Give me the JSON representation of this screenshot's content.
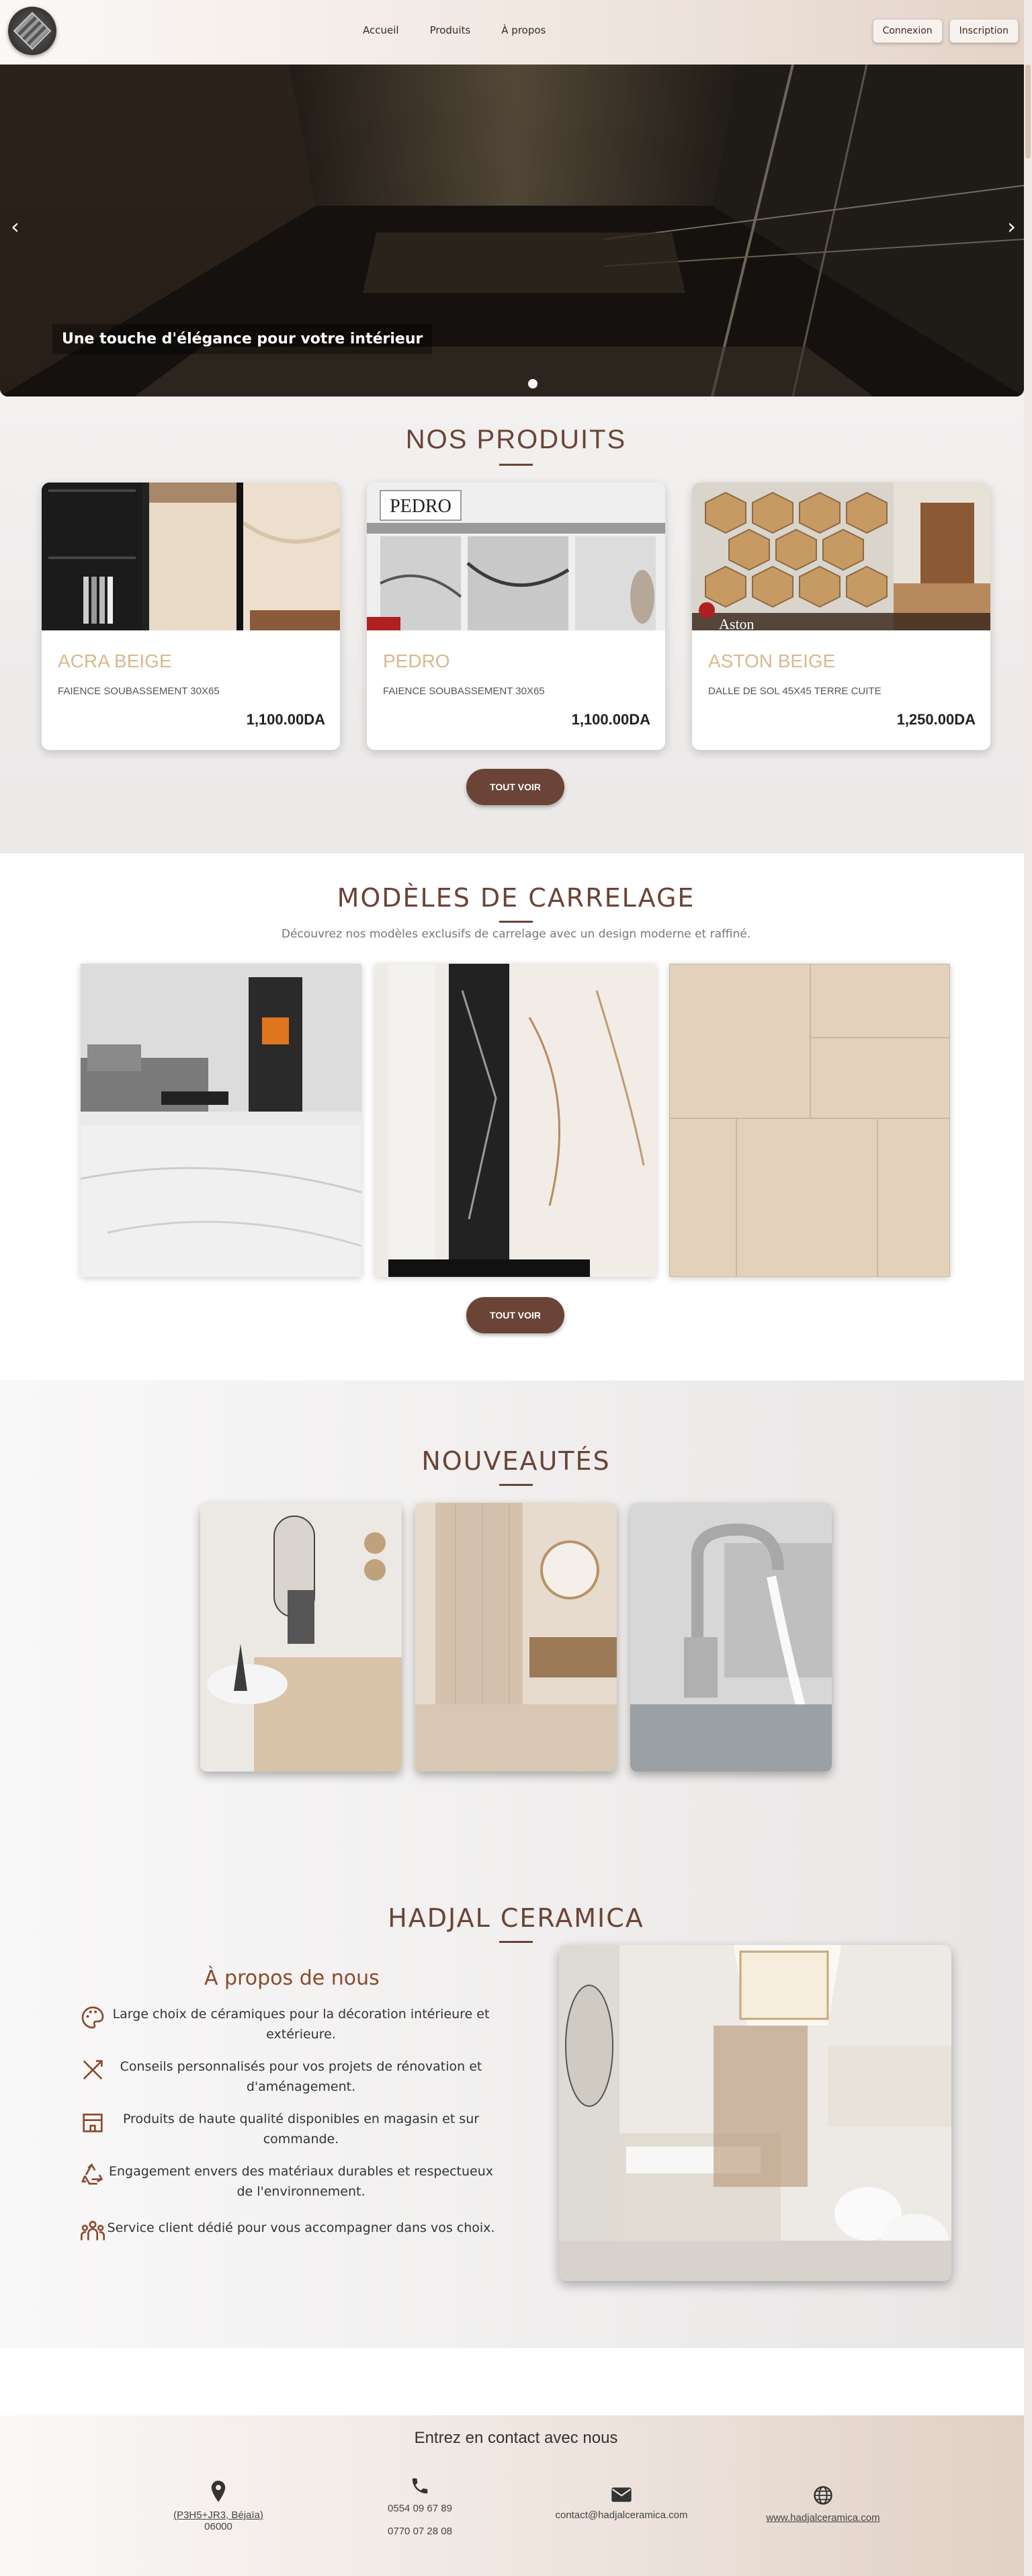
{
  "nav": {
    "links": [
      "Accueil",
      "Produits",
      "À propos"
    ],
    "login": "Connexion",
    "signup": "Inscription"
  },
  "hero": {
    "caption": "Une touche d'élégance pour votre intérieur",
    "prev": "‹",
    "next": "›"
  },
  "products": {
    "title": "NOS PRODUITS",
    "items": [
      {
        "name": "ACRA BEIGE",
        "desc": "FAIENCE SOUBASSEMENT 30X65",
        "price": "1,100.00DA"
      },
      {
        "name": "PEDRO",
        "desc": "FAIENCE SOUBASSEMENT 30X65",
        "price": "1,100.00DA"
      },
      {
        "name": "ASTON BEIGE",
        "desc": "DALLE DE SOL 45X45 TERRE CUITE",
        "price": "1,250.00DA"
      }
    ],
    "button": "TOUT VOIR",
    "image_labels": {
      "pedro": "PEDRO",
      "aston": "Aston"
    }
  },
  "modeles": {
    "title": "MODÈLES DE CARRELAGE",
    "subtitle": "Découvrez nos modèles exclusifs de carrelage avec un design moderne et raffiné.",
    "button": "TOUT VOIR"
  },
  "nouveautes": {
    "title": "NOUVEAUTÉS"
  },
  "about": {
    "title": "HADJAL CERAMICA",
    "subtitle": "À propos de nous",
    "features": [
      {
        "icon": "palette-icon",
        "text": "Large choix de céramiques pour la décoration intérieure et extérieure."
      },
      {
        "icon": "tools-icon",
        "text": "Conseils personnalisés pour vos projets de rénovation et d'aménagement."
      },
      {
        "icon": "store-icon",
        "text": "Produits de haute qualité disponibles en magasin et sur commande."
      },
      {
        "icon": "recycle-icon",
        "text": "Engagement envers des matériaux durables et respectueux de l'environnement."
      },
      {
        "icon": "people-icon",
        "text": "Service client dédié pour vous accompagner dans vos choix."
      }
    ]
  },
  "footer": {
    "title": "Entrez en contact avec nous",
    "address_line1": "(P3H5+JR3, Béjaïa)",
    "address_line2": "06000",
    "phone1": "0554 09 67 89",
    "phone2": "0770 07 28 08",
    "email": "contact@hadjalceramica.com",
    "website": "www.hadjalceramica.com"
  },
  "colors": {
    "brand": "#6b4437",
    "accent_gold": "#d7b98f",
    "about_heading": "#8c4a2c"
  }
}
